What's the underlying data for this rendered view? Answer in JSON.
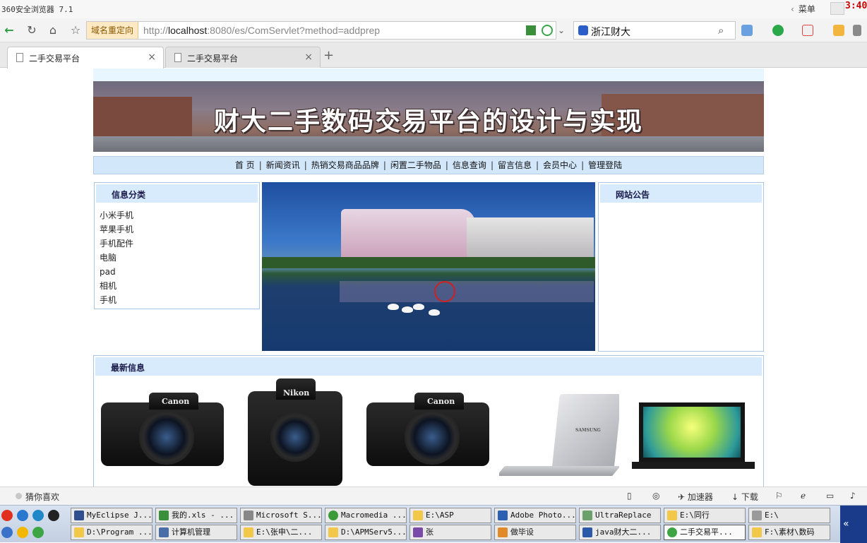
{
  "window": {
    "title": "360安全浏览器 7.1",
    "menu_label": "菜单",
    "clock": "3:40"
  },
  "navbar": {
    "redirect_label": "域名重定向",
    "url_prefix": "http://",
    "url_host": "localhost",
    "url_rest": ":8080/es/ComServlet?method=addprep",
    "search_keyword": "浙江财大"
  },
  "tabs": [
    {
      "label": "二手交易平台",
      "active": true
    },
    {
      "label": "二手交易平台",
      "active": false
    }
  ],
  "site": {
    "banner_title": "财大二手数码交易平台的设计与实现",
    "menu": [
      "首 页",
      "新闻资讯",
      "热销交易商品品牌",
      "闲置二手物品",
      "信息查询",
      "留言信息",
      "会员中心",
      "管理登陆"
    ],
    "menu_separator": "|",
    "category_title": "信息分类",
    "categories": [
      "小米手机",
      "苹果手机",
      "手机配件",
      "电脑",
      "pad",
      "相机",
      "手机"
    ],
    "notice_title": "网站公告",
    "latest_title": "最新信息",
    "products": [
      {
        "brand": "Canon",
        "kind": "camera"
      },
      {
        "brand": "Nikon",
        "kind": "camera"
      },
      {
        "brand": "Canon",
        "kind": "camera"
      },
      {
        "brand": "SAMSUNG",
        "kind": "laptop"
      },
      {
        "brand": "",
        "kind": "laptop"
      }
    ]
  },
  "statusbar": {
    "guess_label": "猜你喜欢",
    "accelerator": "加速器",
    "download": "下载"
  },
  "taskbar": {
    "row1": [
      "MyEclipse J...",
      "我的.xls - ...",
      "Microsoft S...",
      "Macromedia ...",
      "E:\\ASP",
      "Adobe Photo...",
      "UltraReplace",
      "E:\\同行",
      "E:\\"
    ],
    "row2": [
      "D:\\Program ...",
      "计算机管理",
      "E:\\张申\\二...",
      "D:\\APMServ5...",
      "张",
      "做毕设",
      "java财大二...",
      "二手交易平...",
      "F:\\素材\\数码"
    ],
    "tray_chevron": "«"
  }
}
